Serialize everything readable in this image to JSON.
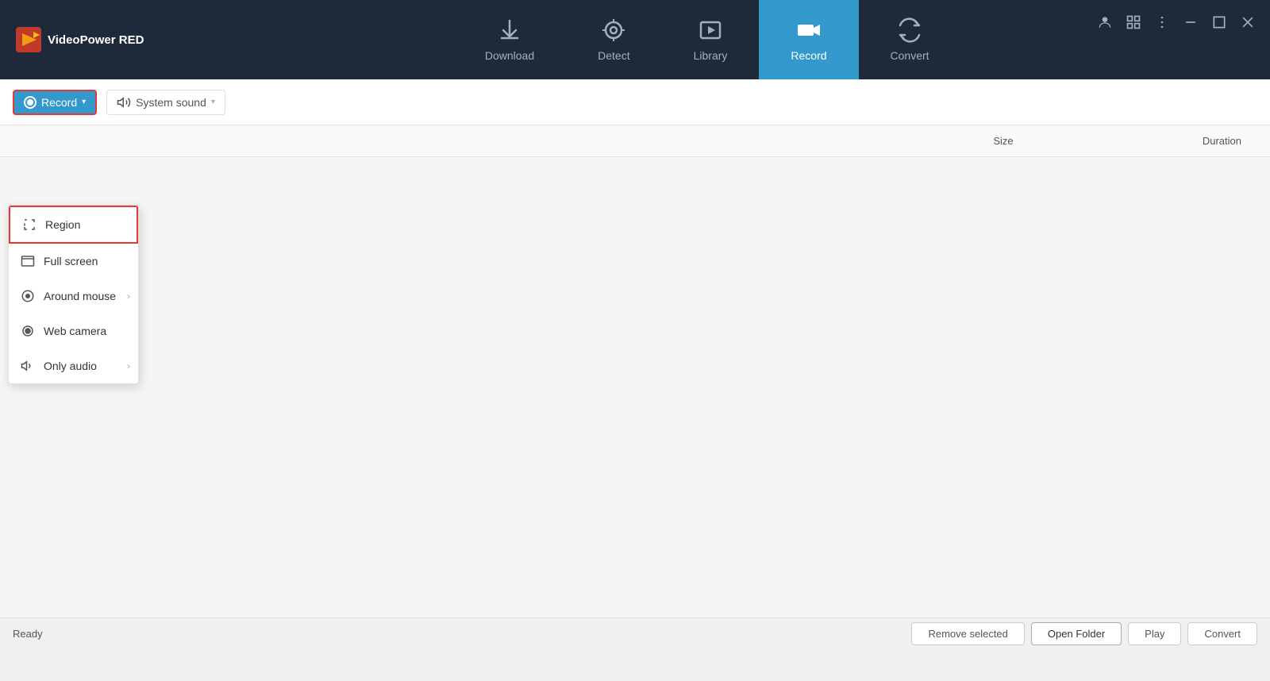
{
  "app": {
    "name": "VideoPower RED"
  },
  "titlebar": {
    "controls": [
      "person-icon",
      "grid-icon",
      "more-icon",
      "minimize-icon",
      "maximize-icon",
      "close-icon"
    ]
  },
  "nav": {
    "tabs": [
      {
        "id": "download",
        "label": "Download",
        "active": false
      },
      {
        "id": "detect",
        "label": "Detect",
        "active": false
      },
      {
        "id": "library",
        "label": "Library",
        "active": false
      },
      {
        "id": "record",
        "label": "Record",
        "active": true
      },
      {
        "id": "convert",
        "label": "Convert",
        "active": false
      }
    ]
  },
  "toolbar": {
    "record_label": "Record",
    "system_sound_label": "System sound"
  },
  "table": {
    "col_size": "Size",
    "col_duration": "Duration"
  },
  "dropdown": {
    "items": [
      {
        "id": "region",
        "label": "Region",
        "has_submenu": false,
        "selected": true
      },
      {
        "id": "fullscreen",
        "label": "Full screen",
        "has_submenu": false,
        "selected": false
      },
      {
        "id": "around-mouse",
        "label": "Around mouse",
        "has_submenu": true,
        "selected": false
      },
      {
        "id": "web-camera",
        "label": "Web camera",
        "has_submenu": false,
        "selected": false
      },
      {
        "id": "only-audio",
        "label": "Only audio",
        "has_submenu": true,
        "selected": false
      }
    ]
  },
  "bottom": {
    "status": "Ready",
    "remove_selected_label": "Remove selected",
    "open_folder_label": "Open Folder",
    "play_label": "Play",
    "convert_label": "Convert"
  }
}
